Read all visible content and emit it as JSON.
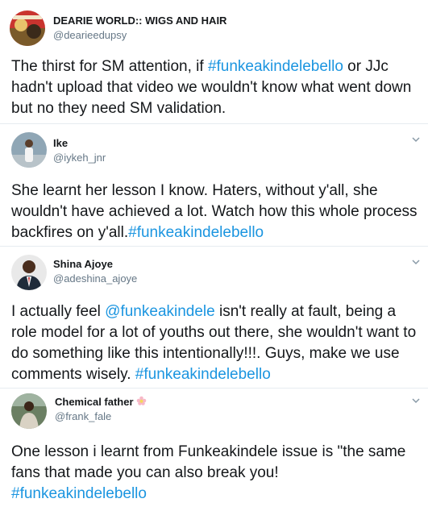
{
  "tweets": [
    {
      "name": "DEARIE WORLD:: WIGS AND HAIR",
      "handle": "@dearieedupsy",
      "parts": {
        "t1": "The thirst for SM attention,  if ",
        "tag1": "#funkeakindelebello",
        "t2": " or JJc hadn't  upload that video we wouldn't  know what went down but no they need SM validation."
      }
    },
    {
      "name": "Ike",
      "handle": "@iykeh_jnr",
      "parts": {
        "t1": "She learnt her lesson I know. Haters, without y'all, she wouldn't have achieved a lot. Watch how this whole process backfires on y'all.",
        "tag1": "#funkeakindelebello"
      }
    },
    {
      "name": "Shina Ajoye",
      "handle": "@adeshina_ajoye",
      "parts": {
        "t1": "I actually feel ",
        "mention1": "@funkeakindele",
        "t2": " isn't really at fault, being a role model for a lot of youths out there, she wouldn't want to do something like this intentionally!!!. Guys, make we use comments wisely. ",
        "tag1": "#funkeakindelebello"
      }
    },
    {
      "name": "Chemical father",
      "handle": "@frank_fale",
      "name_emoji": "flower-emoji",
      "parts": {
        "t1": "One lesson i learnt from Funkeakindele issue is \"the same fans that made you can also break you!",
        "tag1": "#funkeakindelebello"
      }
    }
  ],
  "colors": {
    "link": "#1b95e0",
    "secondary_text": "#657786",
    "divider": "#e6ecf0"
  },
  "icons": {
    "menu": "chevron-down-icon"
  }
}
